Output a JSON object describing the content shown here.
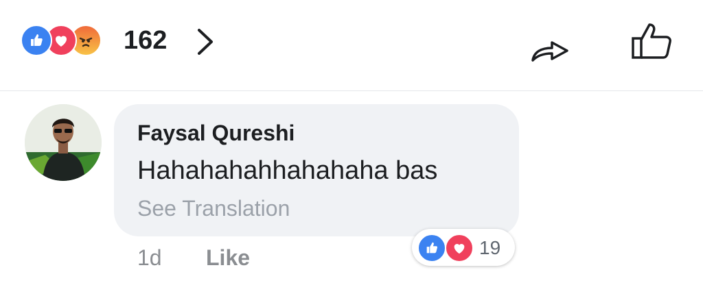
{
  "post_bar": {
    "reaction_icons": [
      "like-icon",
      "love-icon",
      "angry-icon"
    ],
    "reaction_count": "162",
    "actions": [
      "share-icon",
      "like-icon"
    ]
  },
  "comment": {
    "author": "Faysal Qureshi",
    "text": "Hahahahahhahahaha bas",
    "see_translation": "See Translation",
    "time": "1d",
    "like_label": "Like",
    "reaction_icons": [
      "like-icon",
      "love-icon"
    ],
    "reaction_count": "19"
  },
  "colors": {
    "like_blue": "#3b82f1",
    "love_red": "#f0405c",
    "bubble_bg": "#f0f2f5",
    "text_dark": "#1c1e21",
    "text_muted": "#8a8d91"
  }
}
